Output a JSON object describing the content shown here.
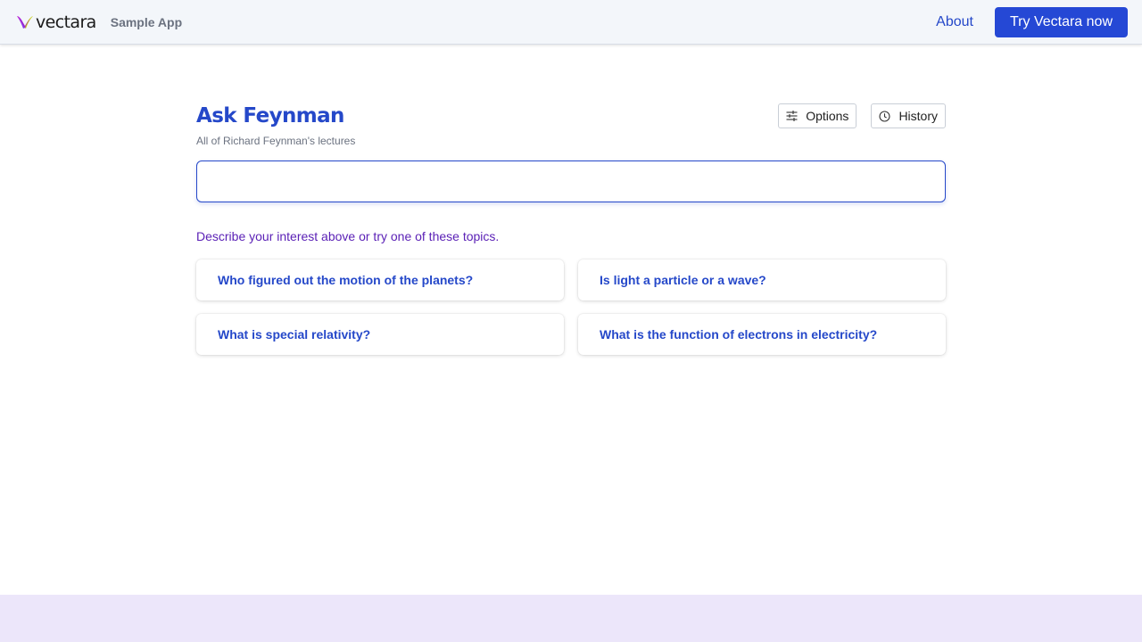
{
  "header": {
    "logo_text": "vectara",
    "app_label": "Sample App",
    "about_label": "About",
    "cta_label": "Try Vectara now"
  },
  "main": {
    "title": "Ask Feynman",
    "subtitle": "All of Richard Feynman's lectures",
    "options_label": "Options",
    "history_label": "History",
    "search_value": "",
    "prompt": "Describe your interest above or try one of these topics.",
    "topics": [
      "Who figured out the motion of the planets?",
      "Is light a particle or a wave?",
      "What is special relativity?",
      "What is the function of electrons in electricity?"
    ]
  },
  "icons": {
    "options": "sliders-icon",
    "history": "clock-icon",
    "logo": "vectara-logo-mark"
  },
  "colors": {
    "accent": "#2548c9",
    "cta": "#2548d5",
    "prompt": "#5b21b6",
    "footer": "#ece6fa",
    "topbar": "#f3f6fa"
  }
}
